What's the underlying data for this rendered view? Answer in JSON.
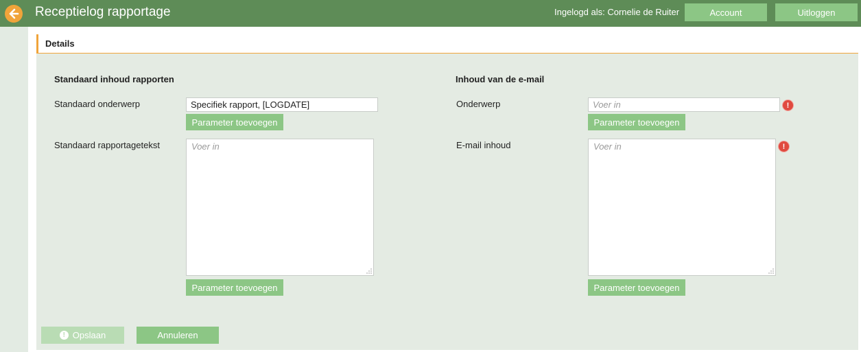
{
  "header": {
    "title": "Receptielog rapportage",
    "login_text": "Ingelogd als: Cornelie de Ruiter",
    "account_label": "Account",
    "logout_label": "Uitloggen"
  },
  "details": {
    "title": "Details"
  },
  "left_section": {
    "title": "Standaard inhoud rapporten",
    "subject_label": "Standaard onderwerp",
    "subject_value": "Specifiek rapport, [LOGDATE]",
    "text_label": "Standaard rapportagetekst",
    "text_placeholder": "Voer in",
    "param_button_label": "Parameter toevoegen"
  },
  "right_section": {
    "title": "Inhoud van de e-mail",
    "subject_label": "Onderwerp",
    "subject_placeholder": "Voer in",
    "body_label": "E-mail inhoud",
    "body_placeholder": "Voer in",
    "param_button_label": "Parameter toevoegen",
    "error_symbol": "!"
  },
  "footer": {
    "save_label": "Opslaan",
    "save_icon_symbol": "!",
    "cancel_label": "Annuleren"
  },
  "colors": {
    "header_green": "#5e8c57",
    "button_green": "#8cc685",
    "accent_orange": "#f0a43a",
    "content_bg": "#e4ebe3",
    "error_red": "#e04a3f"
  },
  "icons": {
    "back": "arrow-left-icon",
    "error": "exclamation-icon",
    "save_warning": "exclamation-icon",
    "resize": "resize-grip-icon"
  }
}
